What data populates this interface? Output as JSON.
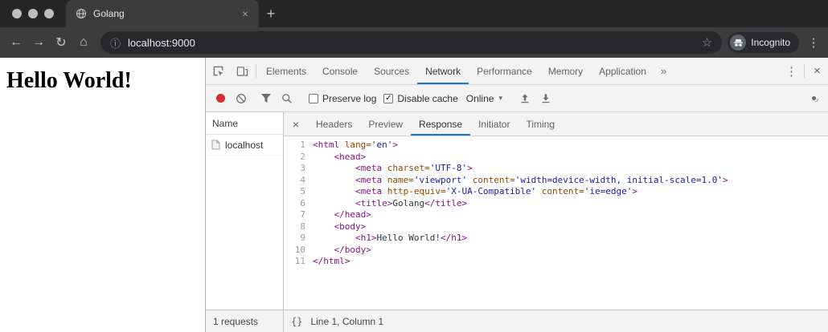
{
  "browser": {
    "tab_title": "Golang",
    "close_glyph": "×",
    "new_tab_glyph": "+",
    "back_glyph": "←",
    "forward_glyph": "→",
    "reload_glyph": "↻",
    "home_glyph": "⌂",
    "info_glyph": "ⓘ",
    "url": "localhost:9000",
    "star_glyph": "☆",
    "incognito_label": "Incognito",
    "menu_glyph": "⋮"
  },
  "page": {
    "heading": "Hello World!"
  },
  "devtools": {
    "main_tabs": [
      {
        "label": "Elements",
        "selected": false
      },
      {
        "label": "Console",
        "selected": false
      },
      {
        "label": "Sources",
        "selected": false
      },
      {
        "label": "Network",
        "selected": true
      },
      {
        "label": "Performance",
        "selected": false
      },
      {
        "label": "Memory",
        "selected": false
      },
      {
        "label": "Application",
        "selected": false
      }
    ],
    "overflow_glyph": "»",
    "menu_glyph": "⋮",
    "close_glyph": "×",
    "network_toolbar": {
      "preserve_log": {
        "label": "Preserve log",
        "checked": false
      },
      "disable_cache": {
        "label": "Disable cache",
        "checked": true
      },
      "check_glyph": "✓",
      "throttling_value": "Online",
      "dropdown_glyph": "▾"
    },
    "requests_pane": {
      "name_header": "Name",
      "rows": [
        {
          "name": "localhost"
        }
      ],
      "status": "1 requests"
    },
    "detail_pane": {
      "close_glyph": "×",
      "tabs": [
        {
          "label": "Headers",
          "selected": false
        },
        {
          "label": "Preview",
          "selected": false
        },
        {
          "label": "Response",
          "selected": true
        },
        {
          "label": "Initiator",
          "selected": false
        },
        {
          "label": "Timing",
          "selected": false
        }
      ],
      "status_braces_glyph": "{}",
      "status_position": "Line 1, Column 1"
    },
    "response": {
      "token_colors": {
        "tag": "#881280",
        "attr": "#994500",
        "val": "#1a1aa6",
        "plain": "#303942"
      },
      "lines": [
        {
          "num": "1",
          "tokens": [
            [
              "tag",
              "<html"
            ],
            [
              "attr",
              " lang="
            ],
            [
              "val",
              "'en'"
            ],
            [
              "tag",
              ">"
            ]
          ]
        },
        {
          "num": "2",
          "tokens": [
            [
              "plain",
              "    "
            ],
            [
              "tag",
              "<head>"
            ]
          ]
        },
        {
          "num": "3",
          "tokens": [
            [
              "plain",
              "        "
            ],
            [
              "tag",
              "<meta"
            ],
            [
              "attr",
              " charset="
            ],
            [
              "val",
              "'UTF-8'"
            ],
            [
              "tag",
              ">"
            ]
          ]
        },
        {
          "num": "4",
          "tokens": [
            [
              "plain",
              "        "
            ],
            [
              "tag",
              "<meta"
            ],
            [
              "attr",
              " name="
            ],
            [
              "val",
              "'viewport'"
            ],
            [
              "attr",
              " content="
            ],
            [
              "val",
              "'width=device-width, initial-scale=1.0'"
            ],
            [
              "tag",
              ">"
            ]
          ]
        },
        {
          "num": "5",
          "tokens": [
            [
              "plain",
              "        "
            ],
            [
              "tag",
              "<meta"
            ],
            [
              "attr",
              " http-equiv="
            ],
            [
              "val",
              "'X-UA-Compatible'"
            ],
            [
              "attr",
              " content="
            ],
            [
              "val",
              "'ie=edge'"
            ],
            [
              "tag",
              ">"
            ]
          ]
        },
        {
          "num": "6",
          "tokens": [
            [
              "plain",
              "        "
            ],
            [
              "tag",
              "<title>"
            ],
            [
              "plain",
              "Golang"
            ],
            [
              "tag",
              "</title>"
            ]
          ]
        },
        {
          "num": "7",
          "tokens": [
            [
              "plain",
              "    "
            ],
            [
              "tag",
              "</head>"
            ]
          ]
        },
        {
          "num": "8",
          "tokens": [
            [
              "plain",
              "    "
            ],
            [
              "tag",
              "<body>"
            ]
          ]
        },
        {
          "num": "9",
          "tokens": [
            [
              "plain",
              "        "
            ],
            [
              "tag",
              "<h1>"
            ],
            [
              "plain",
              "Hello World!"
            ],
            [
              "tag",
              "</h1>"
            ]
          ]
        },
        {
          "num": "10",
          "tokens": [
            [
              "plain",
              "    "
            ],
            [
              "tag",
              "</body>"
            ]
          ]
        },
        {
          "num": "11",
          "tokens": [
            [
              "tag",
              "</html>"
            ]
          ]
        }
      ]
    }
  }
}
